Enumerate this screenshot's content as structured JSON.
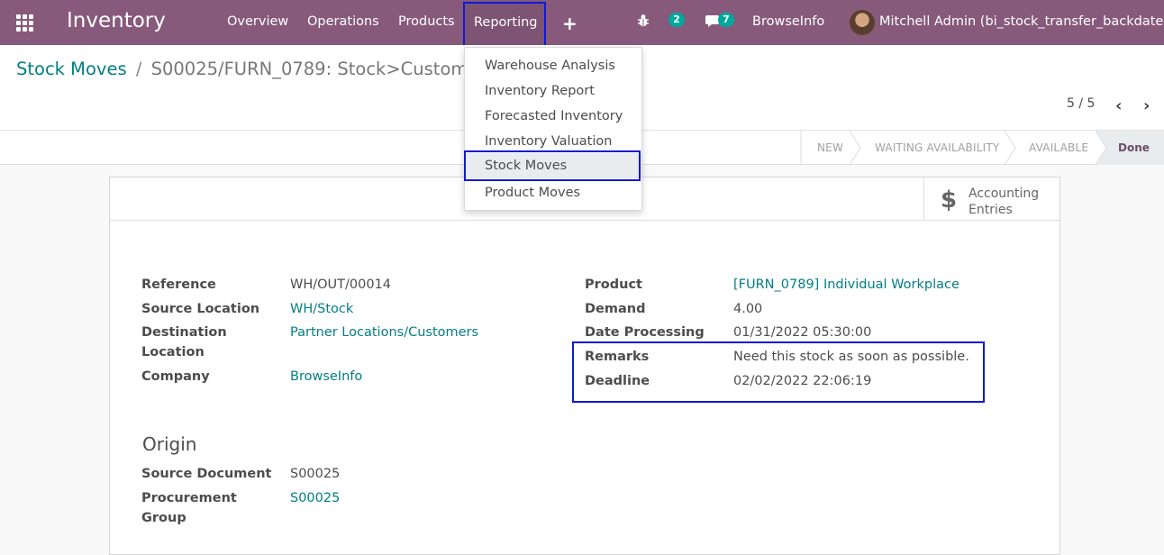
{
  "navbar": {
    "brand": "Inventory",
    "menu": [
      "Overview",
      "Operations",
      "Products",
      "Reporting"
    ],
    "activity_count": "2",
    "message_count": "7",
    "company": "BrowseInfo",
    "user": "Mitchell Admin (bi_stock_transfer_backdate)"
  },
  "breadcrumb": {
    "parent": "Stock Moves",
    "separator": "/",
    "current": "S00025/FURN_0789: Stock>Custom"
  },
  "pager": {
    "value": "5 / 5"
  },
  "statusbar": {
    "stages": [
      "New",
      "Waiting Availability",
      "Available",
      "Done"
    ],
    "active": "Done"
  },
  "buttons": {
    "accounting_entries": "Accounting Entries"
  },
  "form": {
    "left": [
      {
        "label": "Reference",
        "value": "WH/OUT/00014",
        "link": false
      },
      {
        "label": "Source Location",
        "value": "WH/Stock",
        "link": true
      },
      {
        "label": "Destination Location",
        "value": "Partner Locations/Customers",
        "link": true
      },
      {
        "label": "Company",
        "value": "BrowseInfo",
        "link": true
      }
    ],
    "right": [
      {
        "label": "Product",
        "value": "[FURN_0789] Individual Workplace",
        "link": true
      },
      {
        "label": "Demand",
        "value": "4.00",
        "link": false
      },
      {
        "label": "Date Processing",
        "value": "01/31/2022 05:30:00",
        "link": false
      },
      {
        "label": "Remarks",
        "value": "Need this stock as soon as possible.",
        "link": false
      },
      {
        "label": "Deadline",
        "value": "02/02/2022 22:06:19",
        "link": false
      }
    ],
    "origin_title": "Origin",
    "origin": [
      {
        "label": "Source Document",
        "value": "S00025",
        "link": false
      },
      {
        "label": "Procurement Group",
        "value": "S00025",
        "link": true
      }
    ]
  },
  "dropdown": {
    "items": [
      "Warehouse Analysis",
      "Inventory Report",
      "Forecasted Inventory",
      "Inventory Valuation",
      "Stock Moves",
      "Product Moves"
    ],
    "active": "Stock Moves"
  },
  "colors": {
    "brand": "#875a7b",
    "link": "#017e84",
    "highlight": "#0d1bd6",
    "badge": "#01a89e"
  }
}
